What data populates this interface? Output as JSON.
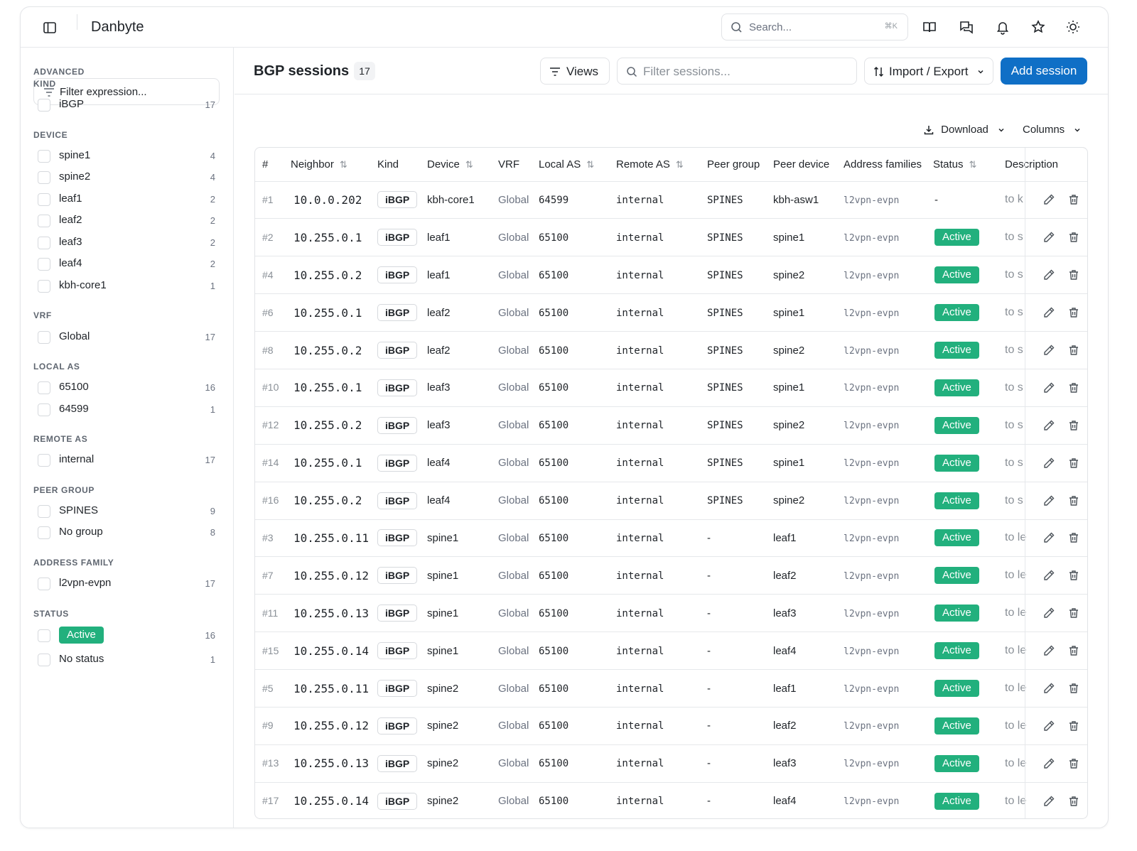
{
  "app": {
    "title": "Danbyte"
  },
  "search": {
    "placeholder": "Search...",
    "shortcut": "⌘K"
  },
  "sidebar": {
    "advanced": {
      "label": "ADVANCED",
      "filter_placeholder": "Filter expression..."
    },
    "groups": [
      {
        "label": "KIND",
        "items": [
          {
            "label": "iBGP",
            "count": "17"
          }
        ]
      },
      {
        "label": "DEVICE",
        "items": [
          {
            "label": "spine1",
            "count": "4"
          },
          {
            "label": "spine2",
            "count": "4"
          },
          {
            "label": "leaf1",
            "count": "2"
          },
          {
            "label": "leaf2",
            "count": "2"
          },
          {
            "label": "leaf3",
            "count": "2"
          },
          {
            "label": "leaf4",
            "count": "2"
          },
          {
            "label": "kbh-core1",
            "count": "1"
          }
        ]
      },
      {
        "label": "VRF",
        "items": [
          {
            "label": "Global",
            "count": "17"
          }
        ]
      },
      {
        "label": "LOCAL AS",
        "items": [
          {
            "label": "65100",
            "count": "16"
          },
          {
            "label": "64599",
            "count": "1"
          }
        ]
      },
      {
        "label": "REMOTE AS",
        "items": [
          {
            "label": "internal",
            "count": "17"
          }
        ]
      },
      {
        "label": "PEER GROUP",
        "items": [
          {
            "label": "SPINES",
            "count": "9"
          },
          {
            "label": "No group",
            "count": "8"
          }
        ]
      },
      {
        "label": "ADDRESS FAMILY",
        "items": [
          {
            "label": "l2vpn-evpn",
            "count": "17"
          }
        ]
      },
      {
        "label": "STATUS",
        "items": [
          {
            "label": "Active",
            "count": "16",
            "badge": true
          },
          {
            "label": "No status",
            "count": "1"
          }
        ]
      }
    ]
  },
  "main": {
    "title": "BGP sessions",
    "count": "17",
    "views_label": "Views",
    "filter_placeholder": "Filter sessions...",
    "import_export_label": "Import / Export",
    "add_label": "Add session",
    "download_label": "Download",
    "columns_label": "Columns"
  },
  "table": {
    "columns": [
      "#",
      "Neighbor",
      "Kind",
      "Device",
      "VRF",
      "Local AS",
      "Remote AS",
      "Peer group",
      "Peer device",
      "Address families",
      "Status",
      "Description"
    ],
    "rows": [
      [
        "#1",
        "10.0.0.202",
        "iBGP",
        "kbh-core1",
        "Global",
        "64599",
        "internal",
        "SPINES",
        "kbh-asw1",
        "l2vpn-evpn",
        "-",
        "to k"
      ],
      [
        "#2",
        "10.255.0.1",
        "iBGP",
        "leaf1",
        "Global",
        "65100",
        "internal",
        "SPINES",
        "spine1",
        "l2vpn-evpn",
        "Active",
        "to s"
      ],
      [
        "#4",
        "10.255.0.2",
        "iBGP",
        "leaf1",
        "Global",
        "65100",
        "internal",
        "SPINES",
        "spine2",
        "l2vpn-evpn",
        "Active",
        "to s"
      ],
      [
        "#6",
        "10.255.0.1",
        "iBGP",
        "leaf2",
        "Global",
        "65100",
        "internal",
        "SPINES",
        "spine1",
        "l2vpn-evpn",
        "Active",
        "to s"
      ],
      [
        "#8",
        "10.255.0.2",
        "iBGP",
        "leaf2",
        "Global",
        "65100",
        "internal",
        "SPINES",
        "spine2",
        "l2vpn-evpn",
        "Active",
        "to s"
      ],
      [
        "#10",
        "10.255.0.1",
        "iBGP",
        "leaf3",
        "Global",
        "65100",
        "internal",
        "SPINES",
        "spine1",
        "l2vpn-evpn",
        "Active",
        "to s"
      ],
      [
        "#12",
        "10.255.0.2",
        "iBGP",
        "leaf3",
        "Global",
        "65100",
        "internal",
        "SPINES",
        "spine2",
        "l2vpn-evpn",
        "Active",
        "to s"
      ],
      [
        "#14",
        "10.255.0.1",
        "iBGP",
        "leaf4",
        "Global",
        "65100",
        "internal",
        "SPINES",
        "spine1",
        "l2vpn-evpn",
        "Active",
        "to s"
      ],
      [
        "#16",
        "10.255.0.2",
        "iBGP",
        "leaf4",
        "Global",
        "65100",
        "internal",
        "SPINES",
        "spine2",
        "l2vpn-evpn",
        "Active",
        "to s"
      ],
      [
        "#3",
        "10.255.0.11",
        "iBGP",
        "spine1",
        "Global",
        "65100",
        "internal",
        "-",
        "leaf1",
        "l2vpn-evpn",
        "Active",
        "to le"
      ],
      [
        "#7",
        "10.255.0.12",
        "iBGP",
        "spine1",
        "Global",
        "65100",
        "internal",
        "-",
        "leaf2",
        "l2vpn-evpn",
        "Active",
        "to le"
      ],
      [
        "#11",
        "10.255.0.13",
        "iBGP",
        "spine1",
        "Global",
        "65100",
        "internal",
        "-",
        "leaf3",
        "l2vpn-evpn",
        "Active",
        "to le"
      ],
      [
        "#15",
        "10.255.0.14",
        "iBGP",
        "spine1",
        "Global",
        "65100",
        "internal",
        "-",
        "leaf4",
        "l2vpn-evpn",
        "Active",
        "to le"
      ],
      [
        "#5",
        "10.255.0.11",
        "iBGP",
        "spine2",
        "Global",
        "65100",
        "internal",
        "-",
        "leaf1",
        "l2vpn-evpn",
        "Active",
        "to le"
      ],
      [
        "#9",
        "10.255.0.12",
        "iBGP",
        "spine2",
        "Global",
        "65100",
        "internal",
        "-",
        "leaf2",
        "l2vpn-evpn",
        "Active",
        "to le"
      ],
      [
        "#13",
        "10.255.0.13",
        "iBGP",
        "spine2",
        "Global",
        "65100",
        "internal",
        "-",
        "leaf3",
        "l2vpn-evpn",
        "Active",
        "to le"
      ],
      [
        "#17",
        "10.255.0.14",
        "iBGP",
        "spine2",
        "Global",
        "65100",
        "internal",
        "-",
        "leaf4",
        "l2vpn-evpn",
        "Active",
        "to le"
      ]
    ]
  },
  "colors": {
    "accent": "#0f6fc6",
    "active": "#22b07d",
    "border": "#e1e3e6"
  },
  "icons": [
    "sidebar-toggle-icon",
    "search-icon",
    "book-icon",
    "chat-icon",
    "bell-icon",
    "star-icon",
    "sun-icon",
    "filter-icon",
    "sort-icon",
    "download-icon",
    "chevron-down-icon",
    "pencil-icon",
    "trash-icon"
  ]
}
